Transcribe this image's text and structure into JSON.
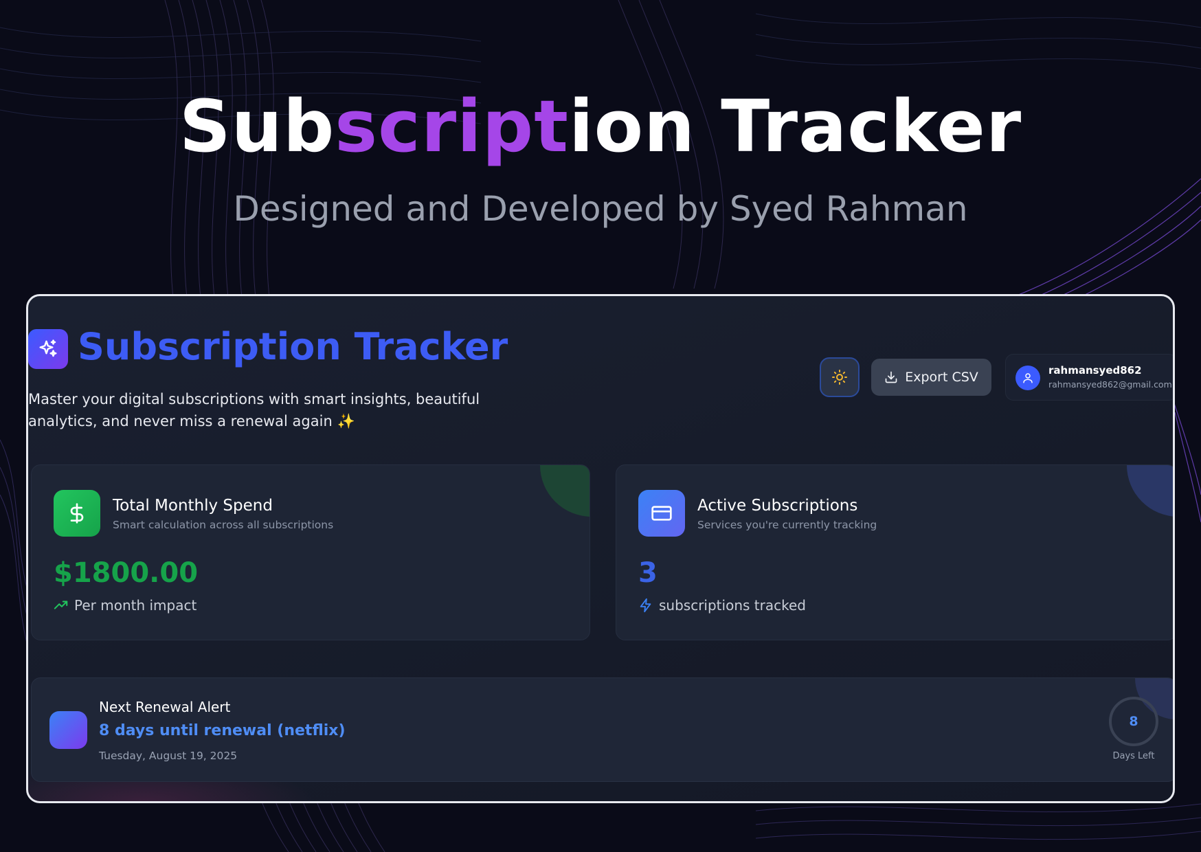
{
  "hero": {
    "title_pre": "Sub",
    "title_accent": "script",
    "title_post": "ion Tracker",
    "subtitle": "Designed and Developed by Syed Rahman"
  },
  "app": {
    "title": "Subscription Tracker",
    "description": "Master your digital subscriptions with smart insights, beautiful analytics, and never miss a renewal again ✨",
    "logo_icon": "sparkles-icon"
  },
  "toolbar": {
    "theme_icon": "sun-icon",
    "export_label": "Export CSV",
    "export_icon": "download-icon"
  },
  "user": {
    "name": "rahmansyed862",
    "email": "rahmansyed862@gmail.com",
    "avatar_icon": "user-icon"
  },
  "stats": {
    "monthly_spend": {
      "title": "Total Monthly Spend",
      "subtitle": "Smart calculation across all subscriptions",
      "value": "$1800.00",
      "footer": "Per month impact",
      "icon": "dollar-icon",
      "footer_icon": "trending-up-icon",
      "accent": "#16a34a"
    },
    "active": {
      "title": "Active Subscriptions",
      "subtitle": "Services you're currently tracking",
      "value": "3",
      "footer": "subscriptions tracked",
      "icon": "credit-card-icon",
      "footer_icon": "bolt-icon",
      "accent": "#3b63e6"
    }
  },
  "renewal": {
    "title": "Next Renewal Alert",
    "message": "8 days until renewal (netflix)",
    "date": "Tuesday, August 19, 2025",
    "days_left": "8",
    "days_label": "Days Left"
  },
  "colors": {
    "background": "#0a0b18",
    "hero_accent": "#a546e8",
    "brand_blue": "#3d5cf5",
    "card": "#1e2535"
  }
}
